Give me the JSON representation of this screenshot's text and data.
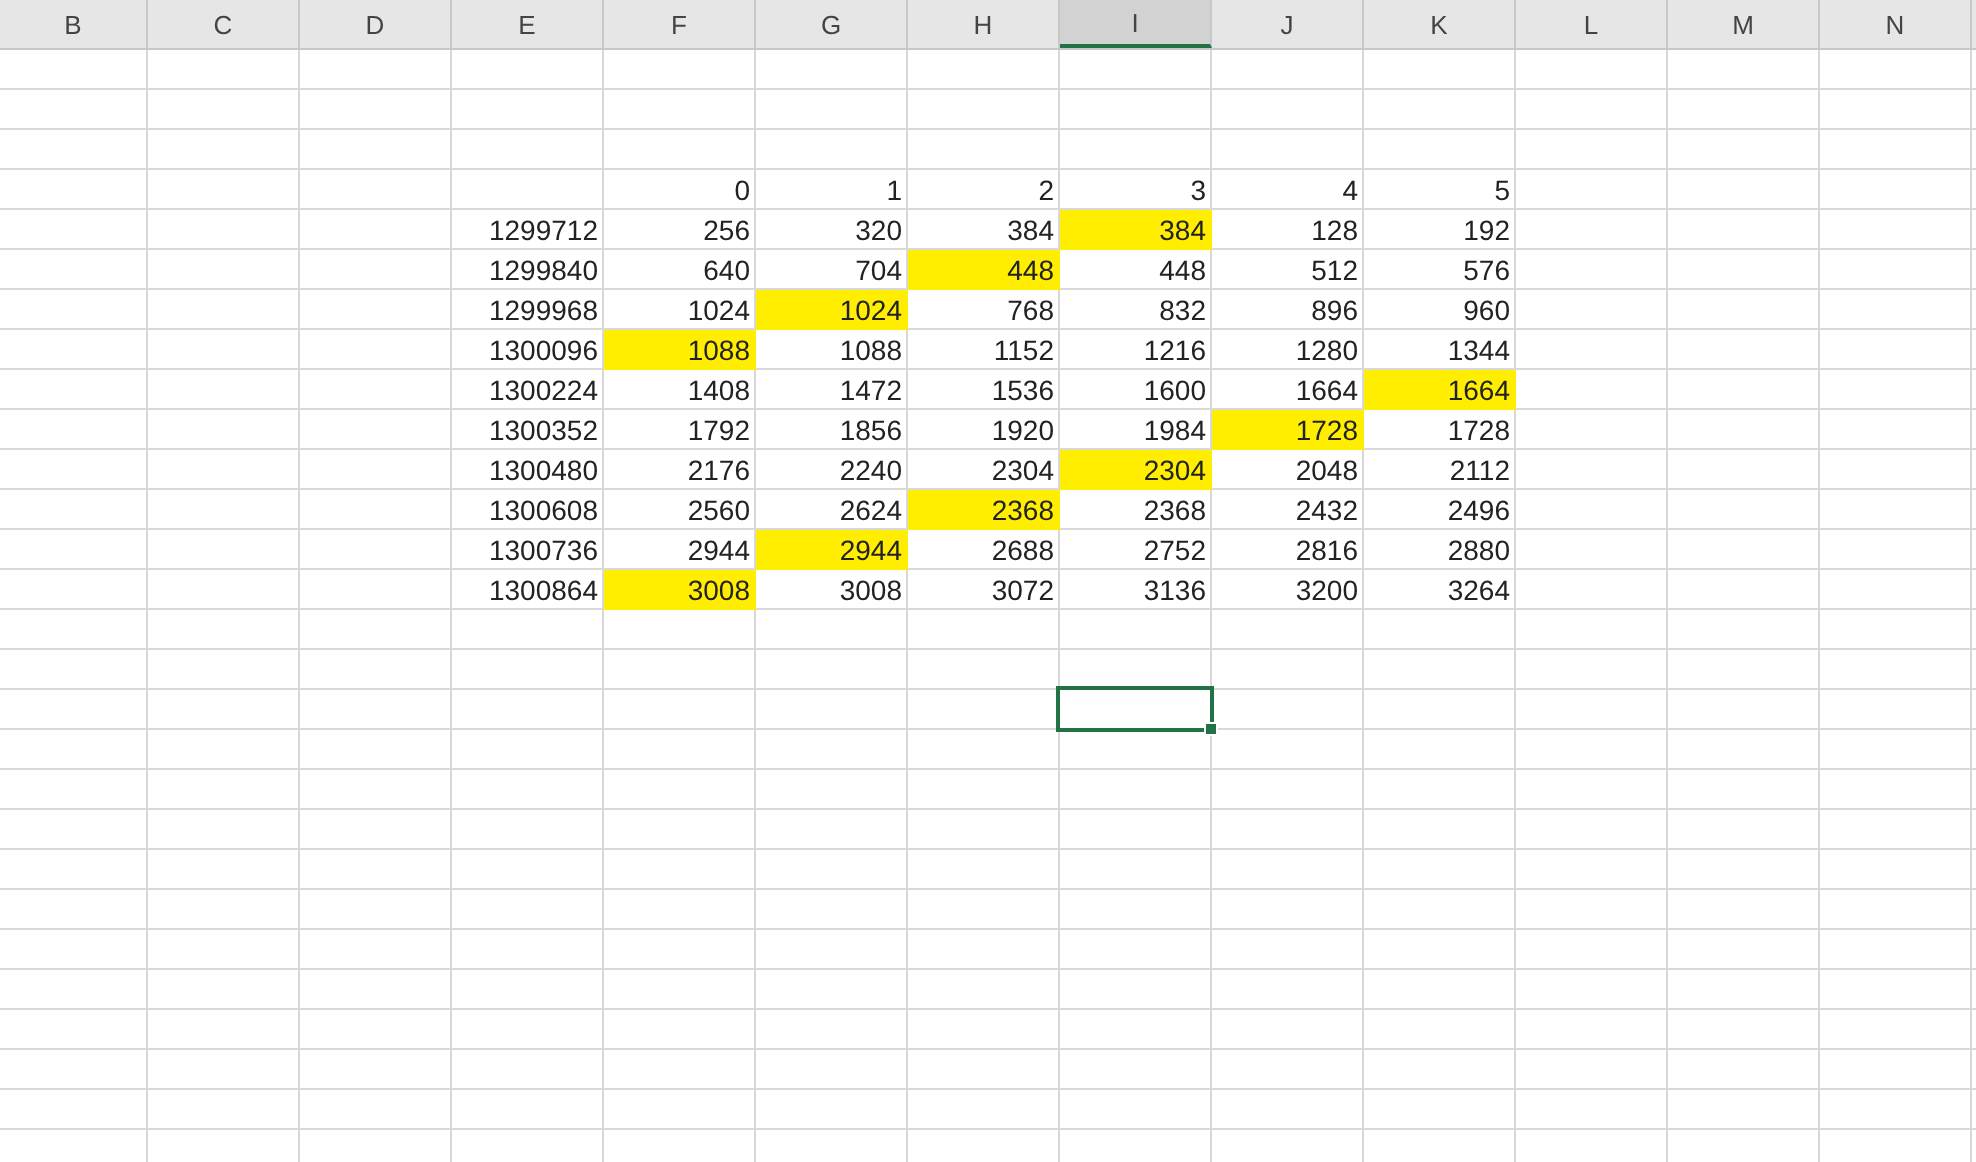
{
  "column_headers": [
    {
      "label": "B",
      "selected": false
    },
    {
      "label": "C",
      "selected": false
    },
    {
      "label": "D",
      "selected": false
    },
    {
      "label": "E",
      "selected": false
    },
    {
      "label": "F",
      "selected": false
    },
    {
      "label": "G",
      "selected": false
    },
    {
      "label": "H",
      "selected": false
    },
    {
      "label": "I",
      "selected": true
    },
    {
      "label": "J",
      "selected": false
    },
    {
      "label": "K",
      "selected": false
    },
    {
      "label": "L",
      "selected": false
    },
    {
      "label": "M",
      "selected": false
    },
    {
      "label": "N",
      "selected": false
    }
  ],
  "table": {
    "header": [
      "0",
      "1",
      "2",
      "3",
      "4",
      "5"
    ],
    "rows": [
      {
        "label": "1299712",
        "cells": [
          {
            "value": "256",
            "highlighted": false
          },
          {
            "value": "320",
            "highlighted": false
          },
          {
            "value": "384",
            "highlighted": false
          },
          {
            "value": "384",
            "highlighted": true
          },
          {
            "value": "128",
            "highlighted": false
          },
          {
            "value": "192",
            "highlighted": false
          }
        ]
      },
      {
        "label": "1299840",
        "cells": [
          {
            "value": "640",
            "highlighted": false
          },
          {
            "value": "704",
            "highlighted": false
          },
          {
            "value": "448",
            "highlighted": true
          },
          {
            "value": "448",
            "highlighted": false
          },
          {
            "value": "512",
            "highlighted": false
          },
          {
            "value": "576",
            "highlighted": false
          }
        ]
      },
      {
        "label": "1299968",
        "cells": [
          {
            "value": "1024",
            "highlighted": false
          },
          {
            "value": "1024",
            "highlighted": true
          },
          {
            "value": "768",
            "highlighted": false
          },
          {
            "value": "832",
            "highlighted": false
          },
          {
            "value": "896",
            "highlighted": false
          },
          {
            "value": "960",
            "highlighted": false
          }
        ]
      },
      {
        "label": "1300096",
        "cells": [
          {
            "value": "1088",
            "highlighted": true
          },
          {
            "value": "1088",
            "highlighted": false
          },
          {
            "value": "1152",
            "highlighted": false
          },
          {
            "value": "1216",
            "highlighted": false
          },
          {
            "value": "1280",
            "highlighted": false
          },
          {
            "value": "1344",
            "highlighted": false
          }
        ]
      },
      {
        "label": "1300224",
        "cells": [
          {
            "value": "1408",
            "highlighted": false
          },
          {
            "value": "1472",
            "highlighted": false
          },
          {
            "value": "1536",
            "highlighted": false
          },
          {
            "value": "1600",
            "highlighted": false
          },
          {
            "value": "1664",
            "highlighted": false
          },
          {
            "value": "1664",
            "highlighted": true
          }
        ]
      },
      {
        "label": "1300352",
        "cells": [
          {
            "value": "1792",
            "highlighted": false
          },
          {
            "value": "1856",
            "highlighted": false
          },
          {
            "value": "1920",
            "highlighted": false
          },
          {
            "value": "1984",
            "highlighted": false
          },
          {
            "value": "1728",
            "highlighted": true
          },
          {
            "value": "1728",
            "highlighted": false
          }
        ]
      },
      {
        "label": "1300480",
        "cells": [
          {
            "value": "2176",
            "highlighted": false
          },
          {
            "value": "2240",
            "highlighted": false
          },
          {
            "value": "2304",
            "highlighted": false
          },
          {
            "value": "2304",
            "highlighted": true
          },
          {
            "value": "2048",
            "highlighted": false
          },
          {
            "value": "2112",
            "highlighted": false
          }
        ]
      },
      {
        "label": "1300608",
        "cells": [
          {
            "value": "2560",
            "highlighted": false
          },
          {
            "value": "2624",
            "highlighted": false
          },
          {
            "value": "2368",
            "highlighted": true
          },
          {
            "value": "2368",
            "highlighted": false
          },
          {
            "value": "2432",
            "highlighted": false
          },
          {
            "value": "2496",
            "highlighted": false
          }
        ]
      },
      {
        "label": "1300736",
        "cells": [
          {
            "value": "2944",
            "highlighted": false
          },
          {
            "value": "2944",
            "highlighted": true
          },
          {
            "value": "2688",
            "highlighted": false
          },
          {
            "value": "2752",
            "highlighted": false
          },
          {
            "value": "2816",
            "highlighted": false
          },
          {
            "value": "2880",
            "highlighted": false
          }
        ]
      },
      {
        "label": "1300864",
        "cells": [
          {
            "value": "3008",
            "highlighted": true
          },
          {
            "value": "3008",
            "highlighted": false
          },
          {
            "value": "3072",
            "highlighted": false
          },
          {
            "value": "3136",
            "highlighted": false
          },
          {
            "value": "3200",
            "highlighted": false
          },
          {
            "value": "3264",
            "highlighted": false
          }
        ]
      }
    ]
  }
}
